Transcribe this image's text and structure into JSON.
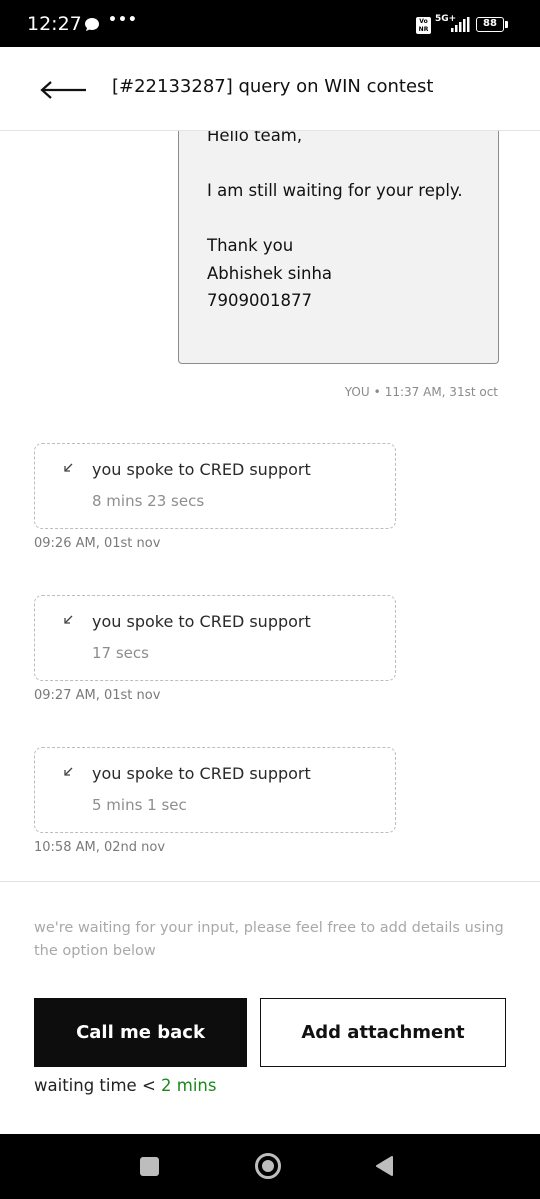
{
  "status_bar": {
    "time": "12:27",
    "dots": "•••",
    "volte_top": "Vo",
    "volte_bottom": "NR",
    "network": "5G+",
    "battery": "88"
  },
  "header": {
    "title": "[#22133287] query on WIN contest"
  },
  "message": {
    "lines": [
      "Hello team,",
      "I am still waiting for your reply.",
      "Thank you",
      "Abhishek sinha",
      "7909001877"
    ],
    "sender": "YOU",
    "time": "11:37 AM, 31st oct"
  },
  "calls": [
    {
      "title": "you spoke to CRED support",
      "duration": "8 mins 23 secs",
      "time": "09:26 AM, 01st nov"
    },
    {
      "title": "you spoke to CRED support",
      "duration": "17 secs",
      "time": "09:27 AM, 01st nov"
    },
    {
      "title": "you spoke to CRED support",
      "duration": "5 mins 1 sec",
      "time": "10:58 AM, 02nd nov"
    }
  ],
  "footer": {
    "note": "we're waiting for your input, please feel free to add details using the option below",
    "call_me_back": "Call me back",
    "add_attachment": "Add attachment",
    "waiting_label": "waiting time <",
    "waiting_value": "2 mins"
  },
  "colors": {
    "accent_green": "#1a8a1a",
    "primary_button": "#0d0d0d",
    "bubble_bg": "#f2f2f2"
  },
  "icons": {
    "back": "arrow-left-icon",
    "call": "arrow-down-left-icon",
    "nav_recent": "square-icon",
    "nav_home": "circle-icon",
    "nav_back": "triangle-back-icon"
  }
}
